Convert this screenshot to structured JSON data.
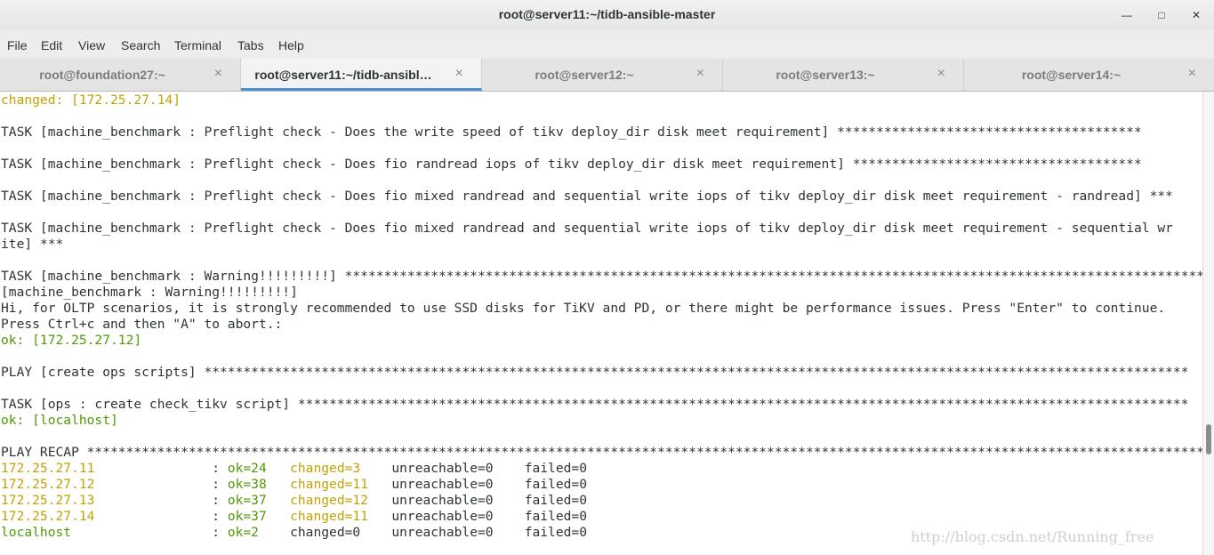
{
  "window": {
    "title": "root@server11:~/tidb-ansible-master",
    "minimize": "—",
    "maximize": "□",
    "close": "✕"
  },
  "menu": [
    "File",
    "Edit",
    "View",
    "Search",
    "Terminal",
    "Tabs",
    "Help"
  ],
  "tabs": [
    {
      "label": "root@foundation27:~",
      "close": "×"
    },
    {
      "label": "root@server11:~/tidb-ansibl…",
      "close": "×"
    },
    {
      "label": "root@server12:~",
      "close": "×"
    },
    {
      "label": "root@server13:~",
      "close": "×"
    },
    {
      "label": "root@server14:~",
      "close": "×"
    }
  ],
  "colors": {
    "text": "#2e3436",
    "changed": "#c4a000",
    "ok": "#4e9a06",
    "accent": "#4a90d9"
  },
  "terminal": {
    "lines": [
      [
        {
          "t": "changed: [172.25.27.14]",
          "c": "changed"
        }
      ],
      [],
      [
        {
          "t": "TASK [machine_benchmark : Preflight check - Does the write speed of tikv deploy_dir disk meet requirement] ***************************************",
          "c": "text"
        }
      ],
      [],
      [
        {
          "t": "TASK [machine_benchmark : Preflight check - Does fio randread iops of tikv deploy_dir disk meet requirement] *************************************",
          "c": "text"
        }
      ],
      [],
      [
        {
          "t": "TASK [machine_benchmark : Preflight check - Does fio mixed randread and sequential write iops of tikv deploy_dir disk meet requirement - randread] ***",
          "c": "text"
        }
      ],
      [],
      [
        {
          "t": "TASK [machine_benchmark : Preflight check - Does fio mixed randread and sequential write iops of tikv deploy_dir disk meet requirement - sequential wr",
          "c": "text"
        }
      ],
      [
        {
          "t": "ite] ***",
          "c": "text"
        }
      ],
      [],
      [
        {
          "t": "TASK [machine_benchmark : Warning!!!!!!!!!] ***************************************************************************************************************",
          "c": "text"
        }
      ],
      [
        {
          "t": "[machine_benchmark : Warning!!!!!!!!!]",
          "c": "text"
        }
      ],
      [
        {
          "t": "Hi, for OLTP scenarios, it is strongly recommended to use SSD disks for TiKV and PD, or there might be performance issues. Press \"Enter\" to continue.",
          "c": "text"
        }
      ],
      [
        {
          "t": "Press Ctrl+c and then \"A\" to abort.:",
          "c": "text"
        }
      ],
      [
        {
          "t": "ok: [172.25.27.12]",
          "c": "ok"
        }
      ],
      [],
      [
        {
          "t": "PLAY [create ops scripts] ******************************************************************************************************************************",
          "c": "text"
        }
      ],
      [],
      [
        {
          "t": "TASK [ops : create check_tikv script] ******************************************************************************************************************",
          "c": "text"
        }
      ],
      [
        {
          "t": "ok: [localhost]",
          "c": "ok"
        }
      ],
      [],
      [
        {
          "t": "PLAY RECAP *****************************************************************************************************************************************************",
          "c": "text"
        }
      ],
      [
        {
          "t": "172.25.27.11",
          "c": "changed"
        },
        {
          "t": "               : ",
          "c": "text"
        },
        {
          "t": "ok=24",
          "c": "ok"
        },
        {
          "t": "   ",
          "c": "text"
        },
        {
          "t": "changed=3",
          "c": "changed"
        },
        {
          "t": "    unreachable=0    failed=0",
          "c": "text"
        }
      ],
      [
        {
          "t": "172.25.27.12",
          "c": "changed"
        },
        {
          "t": "               : ",
          "c": "text"
        },
        {
          "t": "ok=38",
          "c": "ok"
        },
        {
          "t": "   ",
          "c": "text"
        },
        {
          "t": "changed=11",
          "c": "changed"
        },
        {
          "t": "   unreachable=0    failed=0",
          "c": "text"
        }
      ],
      [
        {
          "t": "172.25.27.13",
          "c": "changed"
        },
        {
          "t": "               : ",
          "c": "text"
        },
        {
          "t": "ok=37",
          "c": "ok"
        },
        {
          "t": "   ",
          "c": "text"
        },
        {
          "t": "changed=12",
          "c": "changed"
        },
        {
          "t": "   unreachable=0    failed=0",
          "c": "text"
        }
      ],
      [
        {
          "t": "172.25.27.14",
          "c": "changed"
        },
        {
          "t": "               : ",
          "c": "text"
        },
        {
          "t": "ok=37",
          "c": "ok"
        },
        {
          "t": "   ",
          "c": "text"
        },
        {
          "t": "changed=11",
          "c": "changed"
        },
        {
          "t": "   unreachable=0    failed=0",
          "c": "text"
        }
      ],
      [
        {
          "t": "localhost",
          "c": "ok"
        },
        {
          "t": "                  : ",
          "c": "text"
        },
        {
          "t": "ok=2",
          "c": "ok"
        },
        {
          "t": "    changed=0    unreachable=0    failed=0",
          "c": "text"
        }
      ]
    ]
  },
  "watermark": "http://blog.csdn.net/Running_free"
}
